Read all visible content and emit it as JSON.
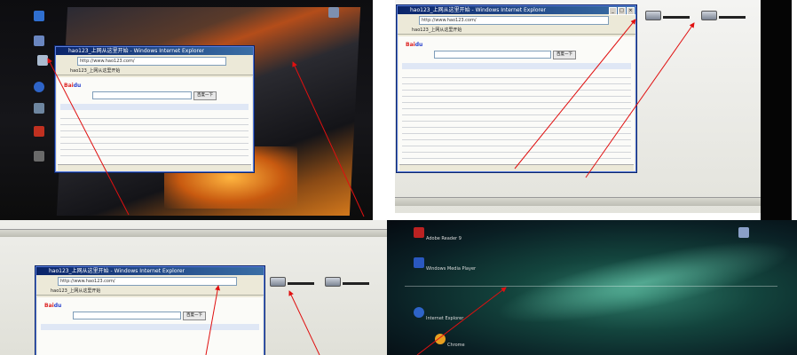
{
  "browser": {
    "window_title": "hao123_上网从这里开始 - Windows Internet Explorer",
    "url": "http://www.hao123.com/",
    "tab_label": "hao123_上网从这里开始",
    "search_button": "百度一下",
    "titlebar_buttons": [
      "_",
      "□",
      "×"
    ]
  },
  "desktop_bottom_right": {
    "icons": [
      {
        "label": "Adobe Reader 9"
      },
      {
        "label": "Windows Media Player"
      },
      {
        "label": "Internet Explorer"
      },
      {
        "label": "Chrome"
      }
    ]
  },
  "colors": {
    "arrow": "#e01010",
    "xp_title": "#0a246a",
    "baidu_red": "#d22222",
    "baidu_blue": "#2740cc"
  },
  "icon_names": [
    "computer-icon",
    "drive-icon",
    "ie-icon",
    "recycle-bin-icon",
    "aurora-wallpaper",
    "mountain-wallpaper"
  ]
}
